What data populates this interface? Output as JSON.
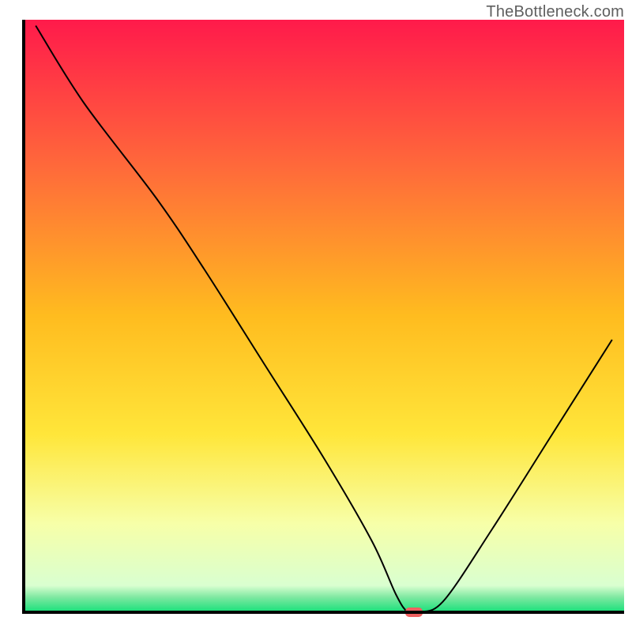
{
  "watermark": "TheBottleneck.com",
  "chart_data": {
    "type": "line",
    "title": "",
    "xlabel": "",
    "ylabel": "",
    "xlim": [
      0,
      100
    ],
    "ylim": [
      0,
      100
    ],
    "background_gradient": {
      "stops": [
        {
          "offset": 0.0,
          "color": "#ff1a4b"
        },
        {
          "offset": 0.25,
          "color": "#ff6a3a"
        },
        {
          "offset": 0.5,
          "color": "#ffbc1f"
        },
        {
          "offset": 0.7,
          "color": "#ffe63a"
        },
        {
          "offset": 0.85,
          "color": "#f7ffa8"
        },
        {
          "offset": 0.955,
          "color": "#d9ffd0"
        },
        {
          "offset": 0.975,
          "color": "#7de8a0"
        },
        {
          "offset": 1.0,
          "color": "#16e07a"
        }
      ]
    },
    "series": [
      {
        "name": "bottleneck-curve",
        "x": [
          2,
          10,
          22,
          30,
          40,
          50,
          58,
          62,
          64,
          66,
          70,
          78,
          88,
          98
        ],
        "y": [
          99,
          86,
          70,
          58,
          42,
          26,
          12,
          3,
          0,
          0,
          2,
          14,
          30,
          46
        ]
      }
    ],
    "marker": {
      "x": 65,
      "y": 0
    }
  }
}
